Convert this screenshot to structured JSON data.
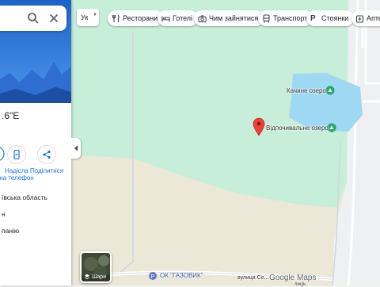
{
  "panel": {
    "coordinates_fragment": ".6\"E",
    "actions": [
      {
        "label_line1": "Надісла",
        "label_line2": "на телефон"
      },
      {
        "label_line1": "Поділитися",
        "label_line2": ""
      }
    ],
    "info_rows": [
      "ївська область",
      "н",
      "панію"
    ]
  },
  "top_bar": {
    "language_label": "Ук",
    "chips": [
      {
        "label": "Ресторани",
        "icon": "fork-knife-icon"
      },
      {
        "label": "Готелі",
        "icon": "bed-icon"
      },
      {
        "label": "Чим зайнятися",
        "icon": "camera-icon"
      },
      {
        "label": "Транспорт",
        "icon": "transit-icon"
      },
      {
        "label": "Стоянки",
        "icon": "parking-icon"
      },
      {
        "label": "Аптек",
        "icon": "pharmacy-icon"
      }
    ]
  },
  "map": {
    "pin_label": "Відпочивальне озеро",
    "lake_label": "Качине озеро",
    "bus_stop_label": "ОК \"ГАЗОВИК\"",
    "street_label": "вулиця Се...",
    "street_label_2": "лицЬ",
    "layers_label": "Шари",
    "logo": "Google Maps",
    "colors": {
      "park": "#c7eed8",
      "lake": "#9fd8f2",
      "field": "#ebe8d8",
      "pin": "#ea4335"
    }
  }
}
